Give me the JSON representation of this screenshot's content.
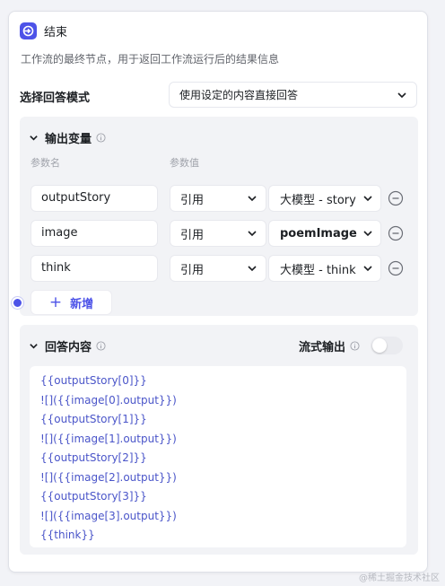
{
  "node": {
    "title": "结束",
    "icon": "end-flag-icon",
    "accent": "#4d53e8",
    "description": "工作流的最终节点，用于返回工作流运行后的结果信息"
  },
  "mode": {
    "label": "选择回答模式",
    "selected": "使用设定的内容直接回答"
  },
  "output": {
    "title": "输出变量",
    "col_name": "参数名",
    "col_value": "参数值",
    "rows": [
      {
        "name": "outputStory",
        "type": "引用",
        "value": "大模型 - story"
      },
      {
        "name": "image",
        "type": "引用",
        "value": "poemImage"
      },
      {
        "name": "think",
        "type": "引用",
        "value": "大模型 - think"
      }
    ],
    "add_label": "新增"
  },
  "answer": {
    "title": "回答内容",
    "stream_label": "流式输出",
    "stream_on": false,
    "lines": [
      "{{outputStory[0]}}",
      "![]({{image[0].output}})",
      "{{outputStory[1]}}",
      "![]({{image[1].output}})",
      "{{outputStory[2]}}",
      "![]({{image[2].output}})",
      "{{outputStory[3]}}",
      "![]({{image[3].output}})",
      "{{think}}"
    ]
  },
  "watermark": "@稀土掘金技术社区"
}
